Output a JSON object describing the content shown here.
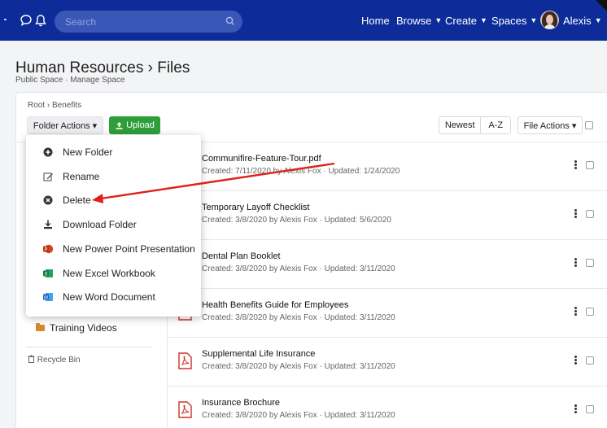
{
  "topbar": {
    "search_placeholder": "Search",
    "nav": [
      {
        "label": "Home",
        "has_caret": false
      },
      {
        "label": "Browse",
        "has_caret": true
      },
      {
        "label": "Create",
        "has_caret": true
      },
      {
        "label": "Spaces",
        "has_caret": true
      }
    ],
    "user": "Alexis",
    "bg_color": "#0d2c9a"
  },
  "header": {
    "title": "Human Resources › Files",
    "subtitle": "Public Space · Manage Space"
  },
  "breadcrumb": "Root  ›  Benefits",
  "toolbar": {
    "folder_actions": "Folder Actions ▾",
    "upload": "Upload",
    "sort_newest": "Newest",
    "sort_az": "A-Z",
    "file_actions": "File Actions ▾"
  },
  "folder_menu": [
    {
      "label": "New Folder",
      "icon": "plus-circle-icon"
    },
    {
      "label": "Rename",
      "icon": "edit-icon"
    },
    {
      "label": "Delete",
      "icon": "x-circle-icon"
    },
    {
      "label": "Download Folder",
      "icon": "download-icon"
    },
    {
      "label": "New Power Point Presentation",
      "icon": "powerpoint-icon"
    },
    {
      "label": "New Excel Workbook",
      "icon": "excel-icon"
    },
    {
      "label": "New Word Document",
      "icon": "word-icon"
    }
  ],
  "sidebar": {
    "folder": "Training Videos",
    "recycle_bin": "Recycle Bin"
  },
  "files": [
    {
      "title": "Communifire-Feature-Tour.pdf",
      "meta": "Created: 7/11/2020 by Alexis Fox  ·  Updated: 1/24/2020"
    },
    {
      "title": "Temporary Layoff Checklist",
      "meta": "Created: 3/8/2020 by Alexis Fox  ·  Updated: 5/6/2020"
    },
    {
      "title": "Dental Plan Booklet",
      "meta": "Created: 3/8/2020 by Alexis Fox  ·  Updated: 3/11/2020"
    },
    {
      "title": "Health Benefits Guide for Employees",
      "meta": "Created: 3/8/2020 by Alexis Fox  ·  Updated: 3/11/2020"
    },
    {
      "title": "Supplemental Life Insurance",
      "meta": "Created: 3/8/2020 by Alexis Fox  ·  Updated: 3/11/2020"
    },
    {
      "title": "Insurance Brochure",
      "meta": "Created: 3/8/2020 by Alexis Fox  ·  Updated: 3/11/2020"
    }
  ],
  "colors": {
    "accent": "#0d2c9a",
    "upload_green": "#2e9e3a",
    "annotation_red": "#e0201b",
    "pdf_red": "#d0302a",
    "folder_orange": "#d4892e"
  }
}
